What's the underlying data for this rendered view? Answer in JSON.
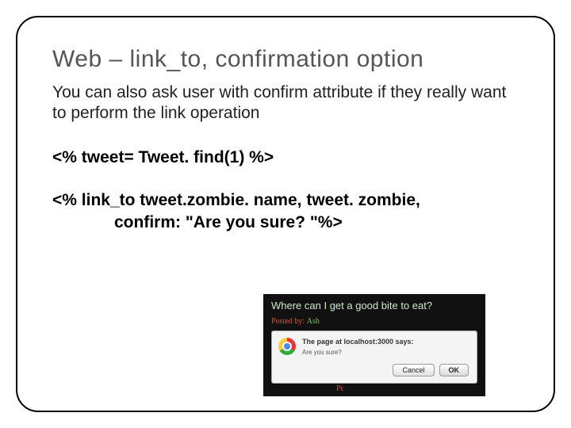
{
  "title": "Web – link_to,    confirmation option",
  "description": "You can also ask user with confirm attribute if they really want to perform the link operation",
  "code_line1": "<%   tweet= Tweet. find(1)   %>",
  "code_line2a": "<% link_to   tweet.zombie. name,   tweet. zombie,",
  "code_line2b": "confirm:   \"Are you sure? \"%>",
  "mockup": {
    "question": "Where can I get a good bite to eat?",
    "posted_label": "Posted by:",
    "posted_name": "Ash",
    "dialog_title": "The page at localhost:3000 says:",
    "dialog_msg": "Are you sure?",
    "cancel": "Cancel",
    "ok": "OK",
    "footer_pct": "Pc"
  }
}
